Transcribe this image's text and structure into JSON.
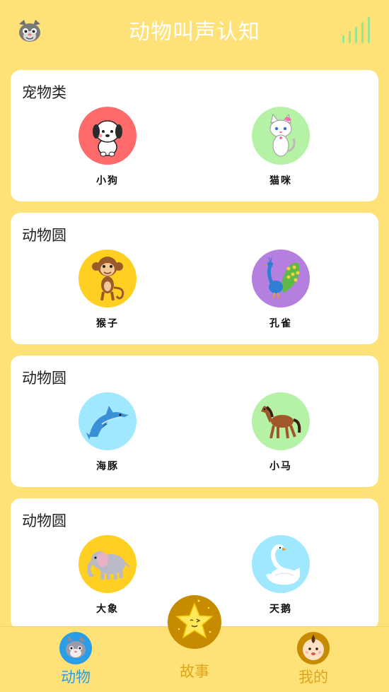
{
  "header": {
    "title": "动物叫声认知",
    "avatar_icon": "cat-avatar-icon",
    "signal_icon": "signal-bars-icon"
  },
  "sections": [
    {
      "title": "宠物类",
      "animals": [
        {
          "name": "小狗",
          "icon": "dog-icon",
          "bg": "#FF6B6B"
        },
        {
          "name": "猫咪",
          "icon": "cat-icon",
          "bg": "#B5F2A6"
        }
      ]
    },
    {
      "title": "动物圆",
      "animals": [
        {
          "name": "猴子",
          "icon": "monkey-icon",
          "bg": "#FFD021"
        },
        {
          "name": "孔雀",
          "icon": "peacock-icon",
          "bg": "#B57FE0"
        }
      ]
    },
    {
      "title": "动物圆",
      "animals": [
        {
          "name": "海豚",
          "icon": "dolphin-icon",
          "bg": "#9FE8FF"
        },
        {
          "name": "小马",
          "icon": "horse-icon",
          "bg": "#B5F2A6"
        }
      ]
    },
    {
      "title": "动物圆",
      "animals": [
        {
          "name": "大象",
          "icon": "elephant-icon",
          "bg": "#FFD021"
        },
        {
          "name": "天鹅",
          "icon": "swan-icon",
          "bg": "#9FE8FF"
        }
      ]
    }
  ],
  "tabbar": {
    "animals_label": "动物",
    "story_label": "故事",
    "mine_label": "我的",
    "active_color": "#2A9DE8",
    "inactive_color": "#E0A419"
  }
}
